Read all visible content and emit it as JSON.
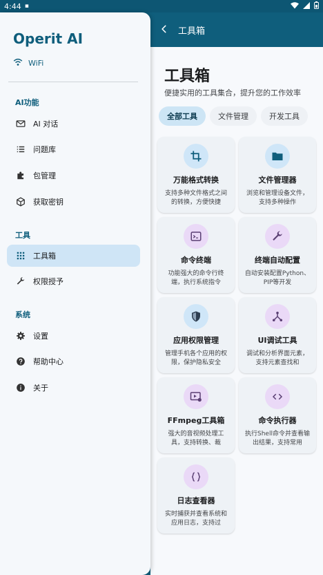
{
  "status_bar": {
    "time": "4:44"
  },
  "app_bar": {
    "title": "工具箱"
  },
  "drawer": {
    "app_title": "Operit AI",
    "network": "WiFi",
    "sections": [
      {
        "title": "AI功能",
        "items": [
          {
            "label": "AI 对话",
            "icon": "mail-icon"
          },
          {
            "label": "问题库",
            "icon": "list-icon"
          },
          {
            "label": "包管理",
            "icon": "puzzle-icon"
          },
          {
            "label": "获取密钥",
            "icon": "cube-icon"
          }
        ]
      },
      {
        "title": "工具",
        "items": [
          {
            "label": "工具箱",
            "icon": "grid-icon",
            "active": true
          },
          {
            "label": "权限授予",
            "icon": "wrench-icon"
          }
        ]
      },
      {
        "title": "系统",
        "items": [
          {
            "label": "设置",
            "icon": "gear-icon"
          },
          {
            "label": "帮助中心",
            "icon": "help-icon"
          },
          {
            "label": "关于",
            "icon": "info-icon"
          }
        ]
      }
    ]
  },
  "main": {
    "title": "工具箱",
    "subtitle": "便捷实用的工具集合，提升您的工作效率",
    "tabs": [
      {
        "label": "全部工具",
        "active": true
      },
      {
        "label": "文件管理"
      },
      {
        "label": "开发工具"
      }
    ],
    "cards": [
      {
        "title": "万能格式转换",
        "desc": "支持多种文件格式之间的转换，方便快捷",
        "icon": "crop-icon",
        "tint": "blue"
      },
      {
        "title": "文件管理器",
        "desc": "浏览和管理设备文件，支持多种操作",
        "icon": "folder-icon",
        "tint": "blue"
      },
      {
        "title": "命令终端",
        "desc": "功能强大的命令行终端，执行系统指令",
        "icon": "terminal-icon",
        "tint": "purple"
      },
      {
        "title": "终端自动配置",
        "desc": "自动安装配置Python、PIP等开发",
        "icon": "wrench-icon",
        "tint": "purple"
      },
      {
        "title": "应用权限管理",
        "desc": "管理手机各个应用的权限，保护隐私安全",
        "icon": "shield-icon",
        "tint": "blue"
      },
      {
        "title": "UI调试工具",
        "desc": "调试和分析界面元素，支持元素查找和",
        "icon": "tree-icon",
        "tint": "purple"
      },
      {
        "title": "FFmpeg工具箱",
        "desc": "强大的音视频处理工具，支持转换、裁",
        "icon": "video-settings-icon",
        "tint": "purple"
      },
      {
        "title": "命令执行器",
        "desc": "执行Shell命令并查看输出结果，支持常用",
        "icon": "code-icon",
        "tint": "purple"
      },
      {
        "title": "日志查看器",
        "desc": "实时捕获并查看系统和应用日志，支持过",
        "icon": "braces-icon",
        "tint": "purple"
      }
    ]
  },
  "colors": {
    "primary": "#0f5e7c",
    "drawer_bg": "#f5f8fb",
    "active_bg": "#cfe5f6",
    "icon_blue_bg": "#cfe6f8",
    "icon_purple_bg": "#ead9f7"
  }
}
